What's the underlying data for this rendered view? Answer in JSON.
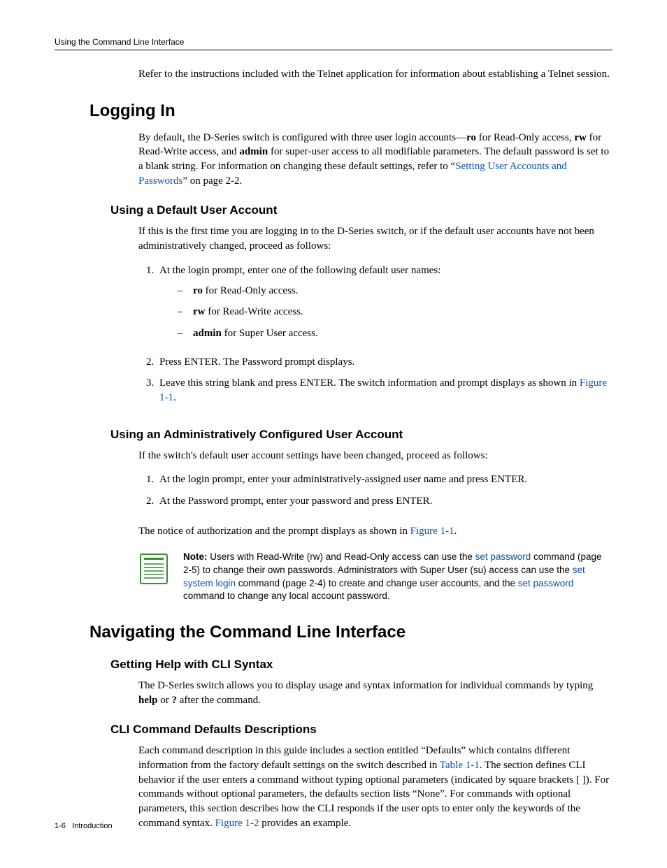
{
  "header": {
    "running": "Using the Command Line Interface"
  },
  "intro_telnet": "Refer to the instructions included with the Telnet application for information about establishing a Telnet session.",
  "logging_in": {
    "title": "Logging In",
    "para_seg1": "By default, the D‑Series switch is configured with three user login accounts—",
    "ro": "ro",
    "para_seg2": " for Read‑Only access, ",
    "rw": "rw",
    "para_seg3": " for Read‑Write access, and ",
    "admin": "admin",
    "para_seg4": " for super‑user access to all modifiable parameters. The default password is set to a blank string. For information on changing these default settings, refer to “",
    "link": "Setting User Accounts and Passwords",
    "para_seg5": "” on page 2‑2."
  },
  "default_account": {
    "title": "Using a Default User Account",
    "intro": "If this is the first time you are logging in to the D‑Series switch, or if the default user accounts have not been administratively changed, proceed as follows:",
    "step1": "At the login prompt, enter one of the following default user names:",
    "opt_ro_b": "ro",
    "opt_ro_t": " for Read‑Only access.",
    "opt_rw_b": "rw",
    "opt_rw_t": " for Read‑Write access.",
    "opt_admin_b": "admin",
    "opt_admin_t": " for Super User access.",
    "step2": "Press ENTER. The Password prompt displays.",
    "step3_a": "Leave this string blank and press ENTER. The switch information and prompt displays as shown in ",
    "step3_link": "Figure 1‑1",
    "step3_b": "."
  },
  "admin_account": {
    "title": "Using an Administratively Configured User Account",
    "intro": "If the switch's default user account settings have been changed, proceed as follows:",
    "step1": "At the login prompt, enter your administratively‑assigned user name and press ENTER.",
    "step2": "At the Password prompt, enter your password and press ENTER.",
    "closing_a": "The notice of authorization and the prompt displays as shown in ",
    "closing_link": "Figure 1‑1",
    "closing_b": "."
  },
  "note": {
    "label": "Note:",
    "seg1": " Users with Read-Write (rw) and Read-Only access can use the ",
    "link1": "set password",
    "seg2": " command (page 2-5) to change their own passwords. Administrators with Super User (su) access can use the ",
    "link2": "set system login",
    "seg3": " command (page 2-4) to create and change user accounts, and the ",
    "link3": "set password",
    "seg4": " command to change any local account password."
  },
  "navigating": {
    "title": "Navigating the Command Line Interface",
    "help": {
      "title": "Getting Help with CLI Syntax",
      "para_a": "The D‑Series switch allows you to display usage and syntax information for individual commands by typing ",
      "help_b": "help",
      "para_b": " or ",
      "q_b": "?",
      "para_c": " after the command."
    },
    "defaults": {
      "title": "CLI Command Defaults Descriptions",
      "para_a": "Each command description in this guide includes a section entitled “Defaults” which contains different information from the factory default settings on the switch described in ",
      "link1": "Table 1‑1",
      "para_b": ". The section defines CLI behavior if the user enters a command without typing optional parameters (indicated by square brackets [ ]). For commands without optional parameters, the defaults section lists “None”. For commands with optional parameters, this section describes how the CLI responds if the user opts to enter only the keywords of the command syntax. ",
      "link2": "Figure 1‑2",
      "para_c": " provides an example."
    }
  },
  "footer": {
    "page": "1-6",
    "chapter": "Introduction"
  }
}
